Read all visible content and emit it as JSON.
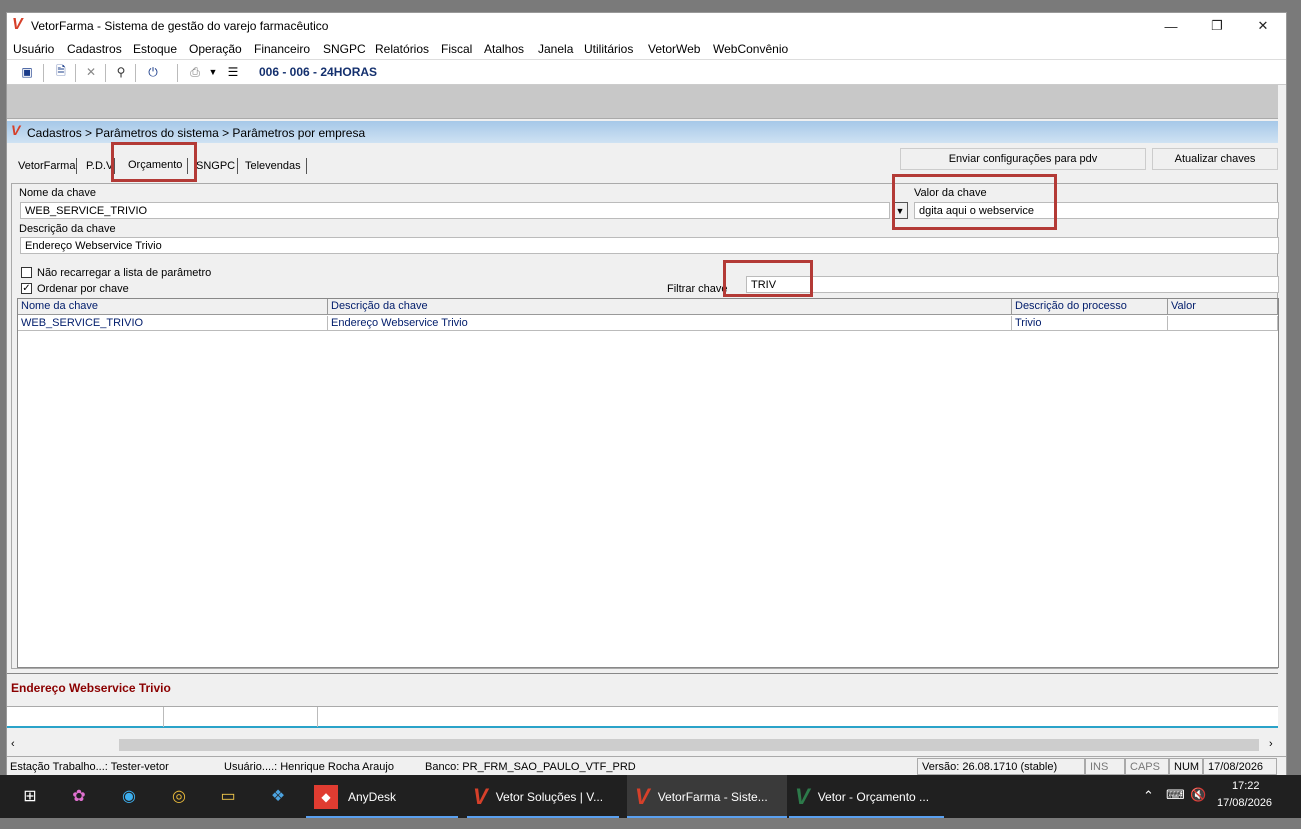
{
  "window": {
    "title": "VetorFarma - Sistema de gestão do varejo farmacêutico",
    "minimize": "—",
    "restore": "❐",
    "close": "✕"
  },
  "menu": [
    "Usuário",
    "Cadastros",
    "Estoque",
    "Operação",
    "Financeiro",
    "SNGPC",
    "Relatórios",
    "Fiscal",
    "Atalhos",
    "Janela",
    "Utilitários",
    "VetorWeb",
    "WebConvênio"
  ],
  "toolbar": {
    "store": "006 - 006 - 24HORAS",
    "icons": [
      "save-icon",
      "new-document-icon",
      "delete-icon",
      "search-icon",
      "power-icon",
      "print-icon",
      "dropdown-icon",
      "export-icon"
    ]
  },
  "breadcrumb": "Cadastros > Parâmetros do sistema > Parâmetros por empresa",
  "tabs": [
    "VetorFarma",
    "P.D.V",
    "Orçamento",
    "SNGPC",
    "Televendas"
  ],
  "buttons": {
    "send_config": "Enviar configurações para  pdv",
    "update_keys": "Atualizar chaves"
  },
  "form": {
    "key_name_label": "Nome da chave",
    "key_name_value": "WEB_SERVICE_TRIVIO",
    "key_value_label": "Valor da chave",
    "key_value_value": "dgita aqui o webservice",
    "key_desc_label": "Descrição da chave",
    "key_desc_value": "Endereço Webservice Trivio",
    "no_reload_label": "Não recarregar a lista de parâmetro",
    "no_reload_checked": false,
    "order_by_key_label": "Ordenar por chave",
    "order_by_key_checked": true,
    "filter_label": "Filtrar chave",
    "filter_value": "TRIV"
  },
  "grid": {
    "columns": [
      "Nome da chave",
      "Descrição  da chave",
      "Descrição do processo",
      "Valor"
    ],
    "rows": [
      [
        "WEB_SERVICE_TRIVIO",
        "Endereço Webservice Trivio",
        "Trivio",
        ""
      ]
    ]
  },
  "description_footer": "Endereço Webservice Trivio",
  "status": {
    "station": "Estação Trabalho...: Tester-vetor",
    "user": "Usuário....: Henrique Rocha Araujo",
    "bank": "Banco: PR_FRM_SAO_PAULO_VTF_PRD",
    "version": "Versão: 26.08.1710 (stable)",
    "ins": "INS",
    "caps": "CAPS",
    "num": "NUM",
    "date": "17/08/2026"
  },
  "taskbar": {
    "apps": [
      "AnyDesk",
      "Vetor Soluções  |  V...",
      "VetorFarma - Siste...",
      "Vetor - Orçamento ..."
    ],
    "time": "17:22",
    "date": "17/08/2026"
  }
}
